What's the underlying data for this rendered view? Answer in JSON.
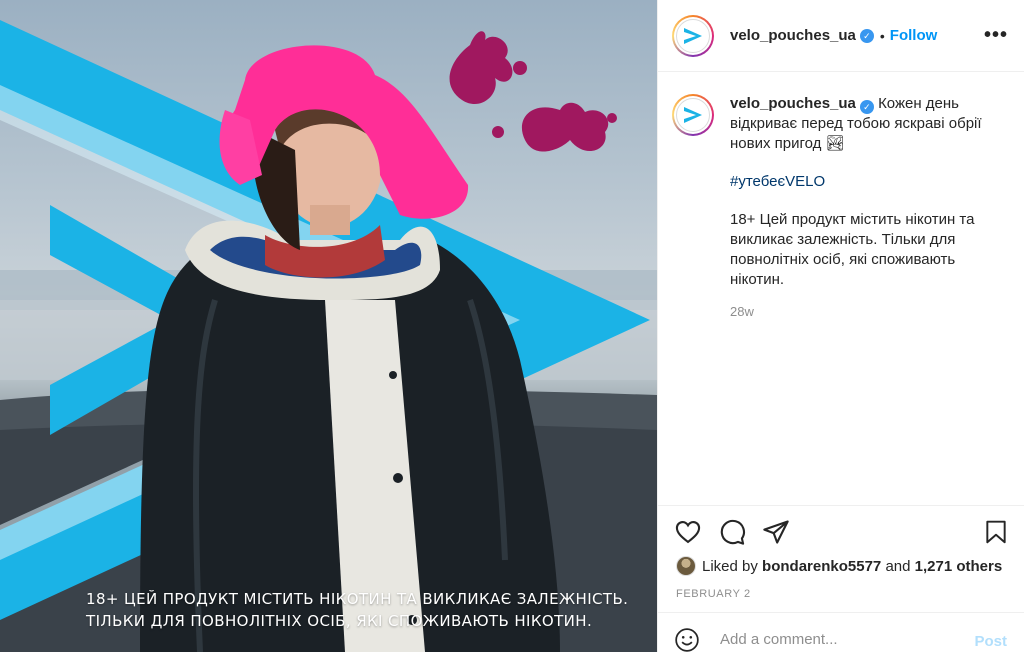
{
  "post": {
    "image_overlay_lines": [
      "18+ ЦЕЙ ПРОДУКТ МІСТИТЬ НІКОТИН ТА ВИКЛИКАЄ ЗАЛЕЖНІСТЬ.",
      "ТІЛЬКИ ДЛЯ ПОВНОЛІТНІХ ОСІБ, ЯКІ СПОЖИВАЮТЬ НІКОТИН."
    ]
  },
  "header": {
    "username": "velo_pouches_ua",
    "separator": "•",
    "follow_label": "Follow",
    "more_label": "•••"
  },
  "caption": {
    "username": "velo_pouches_ua",
    "text": "Кожен день відкриває перед тобою яскраві обрії нових пригод",
    "emoji": "🏞",
    "hashtag": "#утебеєVELO",
    "warning": "18+ Цей продукт містить нікотин та викликає залежність. Тільки для повнолітніх осіб, які споживають нікотин.",
    "time_ago": "28w"
  },
  "likes": {
    "prefix": "Liked by",
    "user": "bondarenko5577",
    "connector": "and",
    "others": "1,271 others"
  },
  "date": "FEBRUARY 2",
  "add_comment": {
    "placeholder": "Add a comment...",
    "post_label": "Post"
  },
  "icons": {
    "like": "heart-icon",
    "comment": "comment-icon",
    "share": "paper-plane-icon",
    "save": "bookmark-icon",
    "emoji": "smiley-icon",
    "verified": "verified-badge-icon",
    "more": "more-options-icon"
  },
  "colors": {
    "accent": "#0095f6",
    "brand_blue": "#1bb3e6",
    "brand_magenta": "#a0185f",
    "hashtag": "#00376b",
    "muted": "#8e8e8e"
  }
}
